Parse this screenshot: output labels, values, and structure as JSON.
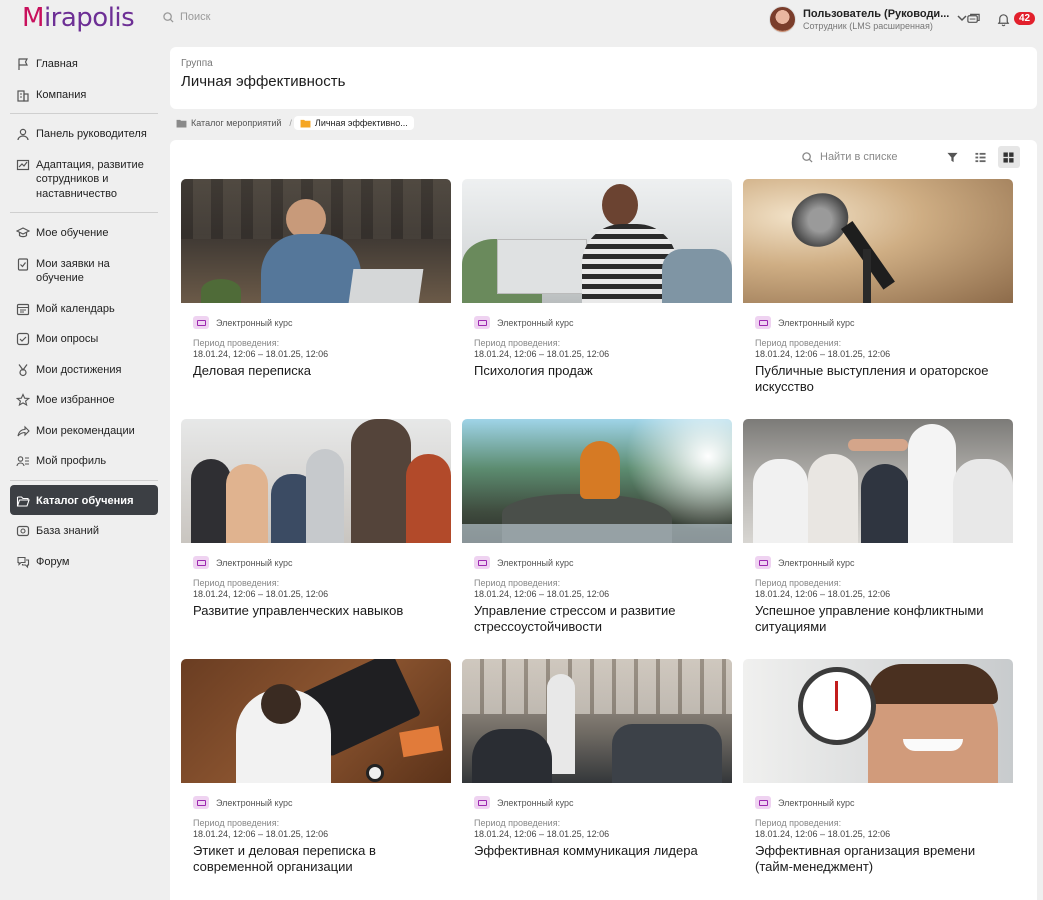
{
  "brand": {
    "logo_m": "M",
    "logo_rest": "irapolis"
  },
  "topbar": {
    "search_placeholder": "Поиск",
    "user_name": "Пользователь (Руководи...",
    "user_role": "Сотрудник (LMS расширенная)",
    "notifications_count": "42"
  },
  "sidebar": {
    "items": [
      {
        "label": "Главная",
        "icon": "flag-icon"
      },
      {
        "label": "Компания",
        "icon": "building-icon"
      },
      {
        "label": "Панель руководителя",
        "icon": "user-panel-icon"
      },
      {
        "label": "Адаптация, развитие сотрудников и наставничество",
        "icon": "chart-icon"
      },
      {
        "label": "Мое обучение",
        "icon": "graduation-icon"
      },
      {
        "label": "Мои заявки на обучение",
        "icon": "clipboard-check-icon"
      },
      {
        "label": "Мой календарь",
        "icon": "calendar-icon"
      },
      {
        "label": "Мои опросы",
        "icon": "checkbox-icon"
      },
      {
        "label": "Мои достижения",
        "icon": "medal-icon"
      },
      {
        "label": "Мое избранное",
        "icon": "star-icon"
      },
      {
        "label": "Мои рекомендации",
        "icon": "share-icon"
      },
      {
        "label": "Мой профиль",
        "icon": "profile-icon"
      },
      {
        "label": "Каталог обучения",
        "icon": "folder-open-icon",
        "active": true
      },
      {
        "label": "База знаний",
        "icon": "database-icon"
      },
      {
        "label": "Форум",
        "icon": "chat-icon"
      }
    ]
  },
  "header": {
    "label": "Группа",
    "title": "Личная эффективность"
  },
  "breadcrumb": {
    "root": "Каталог мероприятий",
    "current": "Личная эффективно..."
  },
  "toolbar": {
    "search_placeholder": "Найти в списке"
  },
  "cards": [
    {
      "type": "Электронный курс",
      "period_label": "Период проведения:",
      "period": "18.01.24, 12:06 – 18.01.25, 12:06",
      "title": "Деловая переписка"
    },
    {
      "type": "Электронный курс",
      "period_label": "Период проведения:",
      "period": "18.01.24, 12:06 – 18.01.25, 12:06",
      "title": "Психология продаж"
    },
    {
      "type": "Электронный курс",
      "period_label": "Период проведения:",
      "period": "18.01.24, 12:06 – 18.01.25, 12:06",
      "title": "Публичные выступления и ораторское искусство"
    },
    {
      "type": "Электронный курс",
      "period_label": "Период проведения:",
      "period": "18.01.24, 12:06 – 18.01.25, 12:06",
      "title": "Развитие управленческих навыков"
    },
    {
      "type": "Электронный курс",
      "period_label": "Период проведения:",
      "period": "18.01.24, 12:06 – 18.01.25, 12:06",
      "title": "Управление стрессом и развитие стрессоустойчивости"
    },
    {
      "type": "Электронный курс",
      "period_label": "Период проведения:",
      "period": "18.01.24, 12:06 – 18.01.25, 12:06",
      "title": "Успешное управление конфликтными ситуациями"
    },
    {
      "type": "Электронный курс",
      "period_label": "Период проведения:",
      "period": "18.01.24, 12:06 – 18.01.25, 12:06",
      "title": "Этикет и деловая переписка в современной организации"
    },
    {
      "type": "Электронный курс",
      "period_label": "Период проведения:",
      "period": "18.01.24, 12:06 – 18.01.25, 12:06",
      "title": "Эффективная коммуникация лидера"
    },
    {
      "type": "Электронный курс",
      "period_label": "Период проведения:",
      "period": "18.01.24, 12:06 – 18.01.25, 12:06",
      "title": "Эффективная организация времени (тайм-менеджмент)"
    }
  ],
  "colors": {
    "brand_pink": "#c8105c",
    "brand_purple": "#6d2f95",
    "active_nav": "#3c3f44",
    "badge": "#e2202c",
    "course_icon": "#9c27b0"
  }
}
